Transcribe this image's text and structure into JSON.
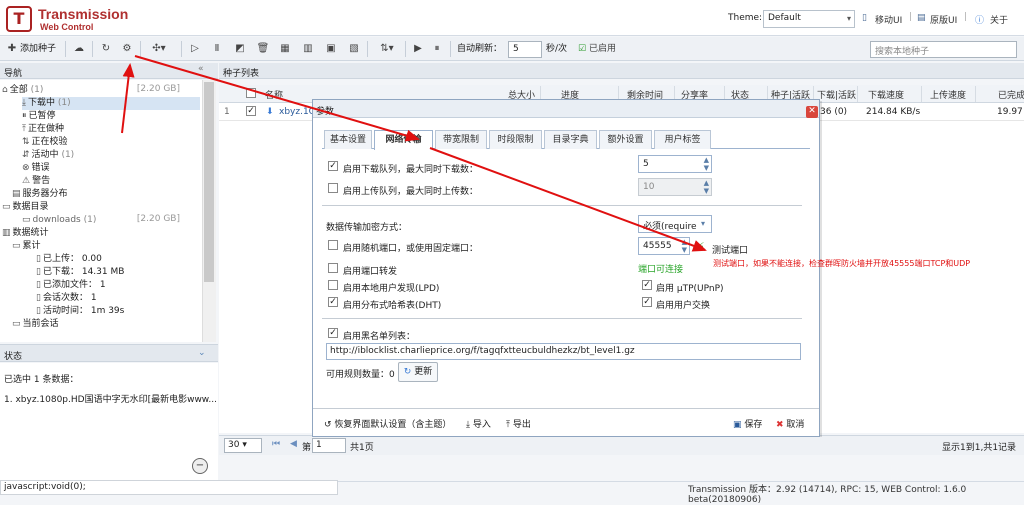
{
  "header": {
    "app_title": "Transmission",
    "app_subtitle": "Web Control",
    "theme_label": "Theme:",
    "theme_value": "Default",
    "mobile_ui": "移动UI",
    "original_ui": "原版UI",
    "about": "关于"
  },
  "toolbar": {
    "add_torrent": "添加种子",
    "auto_refresh_label": "自动刷新：",
    "auto_refresh_value": "5",
    "auto_refresh_unit": "秒/次",
    "enabled_label": "已启用",
    "search_placeholder": "搜索本地种子"
  },
  "nav": {
    "title": "导航",
    "items": [
      {
        "label": "全部",
        "count": "(1)",
        "size": "[2.20 GB]"
      },
      {
        "label": "下载中",
        "count": "(1)"
      },
      {
        "label": "已暂停",
        "count": ""
      },
      {
        "label": "正在做种",
        "count": ""
      },
      {
        "label": "正在校验",
        "count": ""
      },
      {
        "label": "活动中",
        "count": "(1)"
      },
      {
        "label": "错误",
        "count": ""
      },
      {
        "label": "警告",
        "count": ""
      },
      {
        "label": "服务器分布",
        "count": ""
      },
      {
        "label": "数据目录",
        "count": ""
      },
      {
        "label": "downloads",
        "count": "(1)",
        "size": "[2.20 GB]"
      },
      {
        "label": "数据统计",
        "count": ""
      },
      {
        "label": "累计",
        "count": ""
      },
      {
        "label": "已上传：",
        "value": "0.00"
      },
      {
        "label": "已下载：",
        "value": "14.31 MB"
      },
      {
        "label": "已添加文件：",
        "value": "1"
      },
      {
        "label": "会话次数：",
        "value": "1"
      },
      {
        "label": "活动时间：",
        "value": "1m 39s"
      },
      {
        "label": "当前会话",
        "count": ""
      }
    ]
  },
  "status_panel": {
    "title": "状态",
    "selected": "已选中 1 条数据：",
    "item": "1. xbyz.1080p.HD国语中字无水印[最新电影www..."
  },
  "list": {
    "title": "种子列表",
    "columns": [
      "名称",
      "总大小",
      "进度",
      "剩余时间",
      "分享率",
      "状态",
      "种子|活跃",
      "下载|活跃",
      "下载速度",
      "上传速度",
      "已完成"
    ],
    "row": {
      "name": "xbyz.1C",
      "download_peers": "36 (0)",
      "download_speed": "214.84 KB/s",
      "completed": "19.97"
    },
    "page_size": "30",
    "page_label_prefix": "第",
    "page_value": "1",
    "page_label_suffix": "共1页",
    "summary": "显示1到1,共1记录"
  },
  "dialog": {
    "title": "参数",
    "tabs": [
      "基本设置",
      "网络传输",
      "带宽限制",
      "时段限制",
      "目录字典",
      "额外设置",
      "用户标签"
    ],
    "active_tab": "网络传输",
    "download_queue_label": "启用下载队列，最大同时下载数：",
    "download_queue_value": "5",
    "upload_queue_label": "启用上传队列，最大同时上传数：",
    "upload_queue_value": "10",
    "encryption_label": "数据传输加密方式：",
    "encryption_value": "必须(require",
    "random_port_label": "启用随机端口，或使用固定端口：",
    "port_value": "45555",
    "test_port": "测试端口",
    "port_status": "端口可连接",
    "port_forward_label": "启用端口转发",
    "lpd_label": "启用本地用户发现(LPD)",
    "dht_label": "启用分布式哈希表(DHT)",
    "utp_label": "启用 µTP(UPnP)",
    "pex_label": "启用用户交换",
    "blocklist_label": "启用黑名单列表：",
    "blocklist_url": "http://iblocklist.charlieprice.org/f/tagqfxtteucbuldhezkz/bt_level1.gz",
    "rules_count_label": "可用规则数量：0",
    "update_button": "更新",
    "restore_defaults": "恢复界面默认设置（含主题）",
    "import": "导入",
    "export": "导出",
    "save": "保存",
    "cancel": "取消"
  },
  "annotation": {
    "note": "测试端口，如果不能连接，检查群晖防火墙并开放45555端口TCP和UDP",
    "color": "#e01010"
  },
  "footer": {
    "status_url": "javascript:void(0);",
    "version": "Transmission 版本：2.92 (14714), RPC: 15, WEB Control: 1.6.0 beta(20180906)"
  }
}
